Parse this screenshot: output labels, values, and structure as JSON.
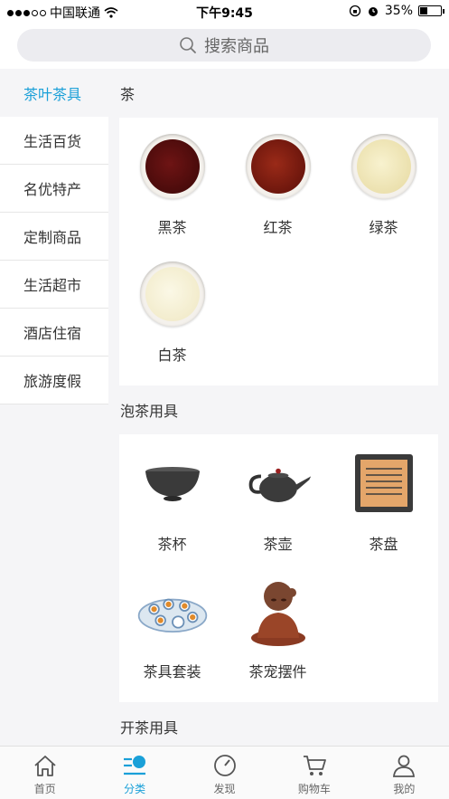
{
  "status_bar": {
    "carrier": "中国联通",
    "time": "下午9:45",
    "battery_percent": "35%",
    "battery_level": 0.35
  },
  "search": {
    "placeholder": "搜索商品"
  },
  "sidebar": {
    "items": [
      {
        "label": "茶叶茶具",
        "active": true
      },
      {
        "label": "生活百货"
      },
      {
        "label": "名优特产"
      },
      {
        "label": "定制商品"
      },
      {
        "label": "生活超市"
      },
      {
        "label": "酒店住宿"
      },
      {
        "label": "旅游度假"
      }
    ]
  },
  "sections": [
    {
      "title": "茶",
      "items": [
        {
          "label": "黑茶",
          "icon": "black-tea-bowl",
          "color": "#5a1010"
        },
        {
          "label": "红茶",
          "icon": "red-tea-bowl",
          "color": "#7a1a10"
        },
        {
          "label": "绿茶",
          "icon": "green-tea-bowl",
          "color": "#f0e6b4"
        },
        {
          "label": "白茶",
          "icon": "white-tea-bowl",
          "color": "#f5efcf"
        }
      ]
    },
    {
      "title": "泡茶用具",
      "items": [
        {
          "label": "茶杯",
          "icon": "tea-cup"
        },
        {
          "label": "茶壶",
          "icon": "teapot"
        },
        {
          "label": "茶盘",
          "icon": "tea-tray"
        },
        {
          "label": "茶具套装",
          "icon": "tea-set"
        },
        {
          "label": "茶宠摆件",
          "icon": "tea-pet-figurine"
        }
      ]
    },
    {
      "title": "开茶用具",
      "items": []
    }
  ],
  "tabbar": {
    "tabs": [
      {
        "label": "首页",
        "icon": "home-icon"
      },
      {
        "label": "分类",
        "icon": "category-icon",
        "active": true
      },
      {
        "label": "发现",
        "icon": "compass-icon"
      },
      {
        "label": "购物车",
        "icon": "cart-icon"
      },
      {
        "label": "我的",
        "icon": "user-icon"
      }
    ]
  },
  "colors": {
    "accent": "#1aa0d8"
  }
}
